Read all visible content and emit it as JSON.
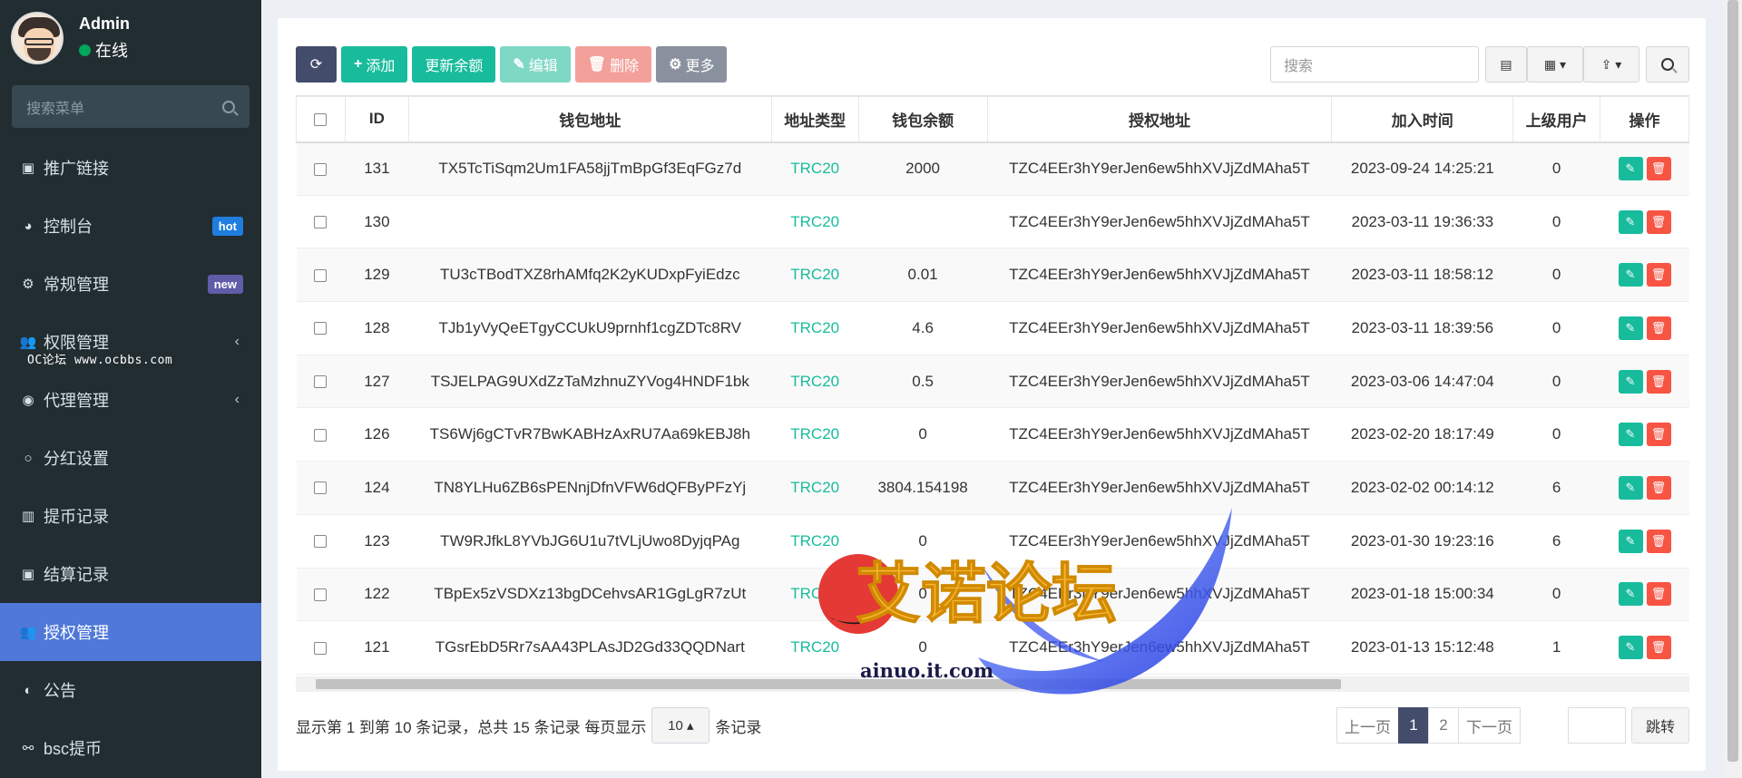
{
  "user": {
    "name": "Admin",
    "status": "在线"
  },
  "sidebar": {
    "search_placeholder": "搜索菜单",
    "items": [
      {
        "label": "推广链接",
        "icon": "id-card-icon"
      },
      {
        "label": "控制台",
        "icon": "dashboard-icon",
        "badge": "hot"
      },
      {
        "label": "常规管理",
        "icon": "cogs-icon",
        "badge": "new"
      },
      {
        "label": "权限管理",
        "icon": "users-icon",
        "chevron": "‹"
      },
      {
        "label": "代理管理",
        "icon": "user-circle-icon",
        "chevron": "‹"
      },
      {
        "label": "分红设置",
        "icon": "circle-icon"
      },
      {
        "label": "提币记录",
        "icon": "bank-icon"
      },
      {
        "label": "结算记录",
        "icon": "id-card-icon"
      },
      {
        "label": "授权管理",
        "icon": "users-icon"
      },
      {
        "label": "公告",
        "icon": "adjust-icon"
      },
      {
        "label": "bsc提币",
        "icon": "bicycle-icon"
      }
    ],
    "watermark": "OC论坛 www.ocbbs.com"
  },
  "toolbar": {
    "refresh_label": "⟳",
    "add_label": "添加",
    "update_label": "更新余额",
    "edit_label": "编辑",
    "delete_label": "删除",
    "more_label": "更多",
    "search_placeholder": "搜索"
  },
  "table": {
    "headers": [
      "ID",
      "钱包地址",
      "地址类型",
      "钱包余额",
      "授权地址",
      "加入时间",
      "上级用户",
      "操作"
    ],
    "rows": [
      {
        "id": "131",
        "wallet": "TX5TcTiSqm2Um1FA58jjTmBpGf3EqFGz7d",
        "type": "TRC20",
        "balance": "2000",
        "auth": "TZC4EEr3hY9erJen6ew5hhXVJjZdMAha5T",
        "time": "2023-09-24 14:25:21",
        "parent": "0"
      },
      {
        "id": "130",
        "wallet": "",
        "type": "TRC20",
        "balance": "",
        "auth": "TZC4EEr3hY9erJen6ew5hhXVJjZdMAha5T",
        "time": "2023-03-11 19:36:33",
        "parent": "0"
      },
      {
        "id": "129",
        "wallet": "TU3cTBodTXZ8rhAMfq2K2yKUDxpFyiEdzc",
        "type": "TRC20",
        "balance": "0.01",
        "auth": "TZC4EEr3hY9erJen6ew5hhXVJjZdMAha5T",
        "time": "2023-03-11 18:58:12",
        "parent": "0"
      },
      {
        "id": "128",
        "wallet": "TJb1yVyQeETgyCCUkU9prnhf1cgZDTc8RV",
        "type": "TRC20",
        "balance": "4.6",
        "auth": "TZC4EEr3hY9erJen6ew5hhXVJjZdMAha5T",
        "time": "2023-03-11 18:39:56",
        "parent": "0"
      },
      {
        "id": "127",
        "wallet": "TSJELPAG9UXdZzTaMzhnuZYVog4HNDF1bk",
        "type": "TRC20",
        "balance": "0.5",
        "auth": "TZC4EEr3hY9erJen6ew5hhXVJjZdMAha5T",
        "time": "2023-03-06 14:47:04",
        "parent": "0"
      },
      {
        "id": "126",
        "wallet": "TS6Wj6gCTvR7BwKABHzAxRU7Aa69kEBJ8h",
        "type": "TRC20",
        "balance": "0",
        "auth": "TZC4EEr3hY9erJen6ew5hhXVJjZdMAha5T",
        "time": "2023-02-20 18:17:49",
        "parent": "0"
      },
      {
        "id": "124",
        "wallet": "TN8YLHu6ZB6sPENnjDfnVFW6dQFByPFzYj",
        "type": "TRC20",
        "balance": "3804.154198",
        "auth": "TZC4EEr3hY9erJen6ew5hhXVJjZdMAha5T",
        "time": "2023-02-02 00:14:12",
        "parent": "6"
      },
      {
        "id": "123",
        "wallet": "TW9RJfkL8YVbJG6U1u7tVLjUwo8DyjqPAg",
        "type": "TRC20",
        "balance": "0",
        "auth": "TZC4EEr3hY9erJen6ew5hhXVJjZdMAha5T",
        "time": "2023-01-30 19:23:16",
        "parent": "6"
      },
      {
        "id": "122",
        "wallet": "TBpEx5zVSDXz13bgDCehvsAR1GgLgR7zUt",
        "type": "TRC20",
        "balance": "0",
        "auth": "TZC4EEr3hY9erJen6ew5hhXVJjZdMAha5T",
        "time": "2023-01-18 15:00:34",
        "parent": "0"
      },
      {
        "id": "121",
        "wallet": "TGsrEbD5Rr7sAA43PLAsJD2Gd33QQDNart",
        "type": "TRC20",
        "balance": "0",
        "auth": "TZC4EEr3hY9erJen6ew5hhXVJjZdMAha5T",
        "time": "2023-01-13 15:12:48",
        "parent": "1"
      }
    ]
  },
  "footer": {
    "summary": "显示第 1 到第 10 条记录，总共 15 条记录 每页显示",
    "page_size": "10 ▴",
    "suffix": "条记录",
    "prev": "上一页",
    "pages": [
      "1",
      "2"
    ],
    "next": "下一页",
    "jump": "跳转"
  },
  "logo": {
    "text": "艾诺论坛",
    "domain": "ainuo.it.com"
  },
  "colors": {
    "sidebar_bg": "#222d32",
    "active": "#4f78d8",
    "success": "#18bc9c",
    "danger": "#f75444",
    "primary_dark": "#444c6b"
  }
}
